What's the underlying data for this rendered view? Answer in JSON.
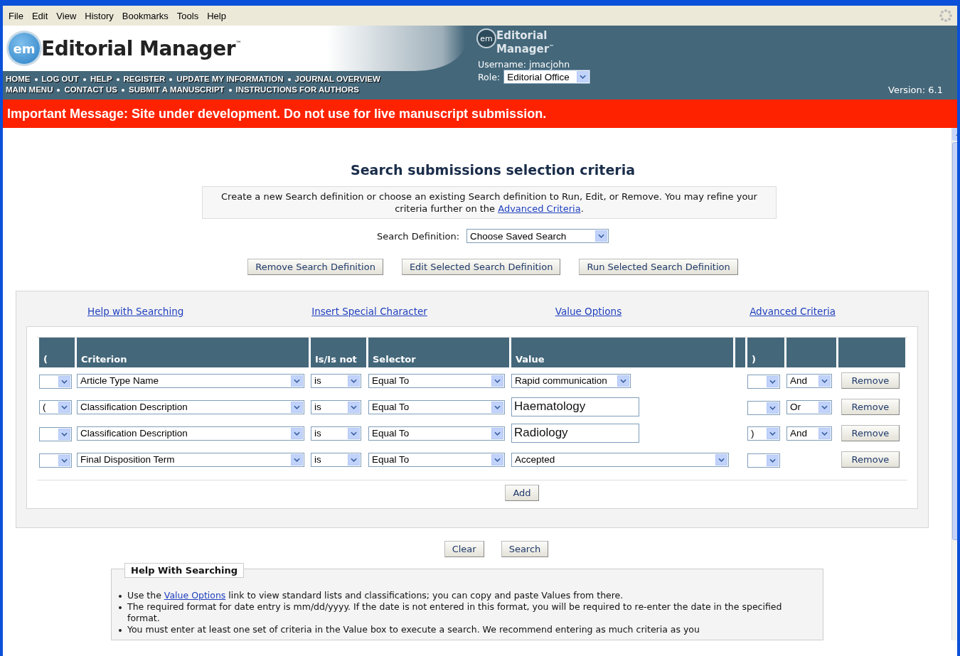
{
  "menu": [
    "File",
    "Edit",
    "View",
    "History",
    "Bookmarks",
    "Tools",
    "Help"
  ],
  "header": {
    "badge": "em",
    "logo": "Editorial Manager",
    "tm": "™",
    "nav": [
      [
        "HOME",
        "LOG OUT",
        "HELP",
        "REGISTER",
        "UPDATE MY INFORMATION",
        "JOURNAL OVERVIEW"
      ],
      [
        "MAIN MENU",
        "CONTACT US",
        "SUBMIT A MANUSCRIPT",
        "INSTRUCTIONS FOR AUTHORS"
      ]
    ],
    "small_logo": {
      "badge": "em",
      "line1": "Editorial",
      "line2": "Manager",
      "tm": "™"
    },
    "username": "Username: jmacjohn",
    "role_label": "Role:",
    "role": "Editorial Office",
    "version": "Version: 6.1"
  },
  "message": "Important Message: Site under development. Do not use for live manuscript submission.",
  "title": "Search submissions selection criteria",
  "intro": {
    "text": "Create a new Search definition or choose an existing Search definition to Run, Edit, or Remove.  You may refine your criteria further on the",
    "link": "Advanced Criteria",
    "end": "."
  },
  "search_definition": {
    "label": "Search Definition:",
    "value": "Choose Saved Search"
  },
  "definition_buttons": [
    "Remove Search Definition",
    "Edit Selected Search Definition",
    "Run Selected Search Definition"
  ],
  "links": [
    "Help with Searching",
    "Insert Special Character",
    "Value Options",
    "Advanced Criteria"
  ],
  "table": {
    "columns": [
      {
        "label": "("
      },
      {
        "label": "Criterion"
      },
      {
        "label": "Is/Is not"
      },
      {
        "label": "Selector"
      },
      {
        "label": "Value"
      },
      {},
      {
        "label": ")"
      },
      {},
      {}
    ],
    "rows": [
      {
        "open": "",
        "criterion": "Article Type Name",
        "is": "is",
        "selector": "Equal To",
        "value": {
          "kind": "short-select",
          "text": "Rapid communication"
        },
        "close": "",
        "conjunction": "And",
        "action": "Remove"
      },
      {
        "open": "(",
        "criterion": "Classification Description",
        "is": "is",
        "selector": "Equal To",
        "value": {
          "kind": "text",
          "text": "Haematology"
        },
        "close": "",
        "conjunction": "Or",
        "action": "Remove"
      },
      {
        "open": "",
        "criterion": "Classification Description",
        "is": "is",
        "selector": "Equal To",
        "value": {
          "kind": "text",
          "text": "Radiology"
        },
        "close": ")",
        "conjunction": "And",
        "action": "Remove"
      },
      {
        "open": "",
        "criterion": "Final Disposition Term",
        "is": "is",
        "selector": "Equal To",
        "value": {
          "kind": "long-select",
          "text": "Accepted"
        },
        "close": "",
        "action": "Remove"
      }
    ],
    "add": "Add"
  },
  "bottom_buttons": [
    "Clear",
    "Search"
  ],
  "help": {
    "legend": "Help With Searching",
    "bullets": [
      {
        "before": "Use the ",
        "link": "Value Options",
        "after": " link to view standard lists and classifications; you can copy and paste Values from there."
      },
      {
        "before": "The required format for date entry is mm/dd/yyyy.  If the date is not entered in this format, you will be required to re-enter the date in the specified format."
      },
      {
        "before": "You must enter at least one set of criteria in the Value box to execute a search. We recommend entering as much criteria as you"
      }
    ]
  }
}
